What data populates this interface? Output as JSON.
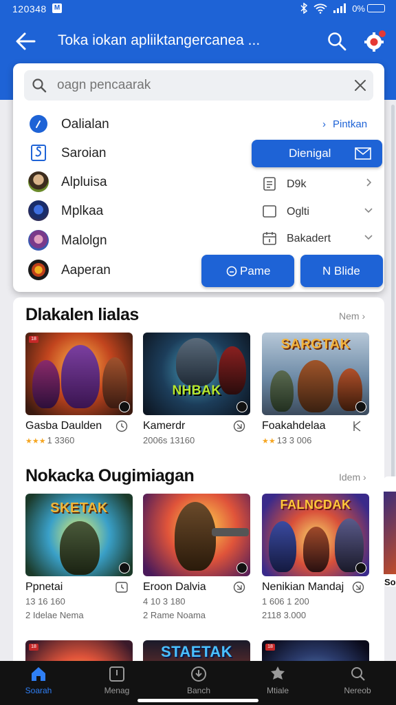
{
  "status_bar": {
    "time": "120348",
    "battery": "0%"
  },
  "app_bar": {
    "title": "Toka iokan apliiktangercanea ..."
  },
  "search": {
    "placeholder": "oagn pencaarak",
    "value": ""
  },
  "dropdown": {
    "options": [
      {
        "label": "Oalialan"
      },
      {
        "label": "Saroian"
      },
      {
        "label": "Alpluisa"
      },
      {
        "label": "Mplkaa"
      },
      {
        "label": "Malolgn"
      },
      {
        "label": "Aaperan"
      }
    ],
    "pin_link": "Pintkan",
    "primary_button": "Dienigal",
    "side_options": [
      {
        "label": "D9k"
      },
      {
        "label": "Oglti"
      },
      {
        "label": "Bakadert"
      }
    ],
    "action_left": "Pame",
    "action_right": "N Blide"
  },
  "sections": [
    {
      "title": "Dlakalen lialas",
      "more": "Nem",
      "cards": [
        {
          "name": "Gasba Daulden",
          "meta": "1 3360",
          "meta2": "",
          "stars": "★★★",
          "art_text": ""
        },
        {
          "name": "Kamerdr",
          "meta": "2006s 13160",
          "meta2": "",
          "stars": "",
          "art_text": "NHBAK"
        },
        {
          "name": "Foakahdelaa",
          "meta": "13 3 006",
          "meta2": "",
          "stars": "★★",
          "art_text": "SARGTAK"
        }
      ]
    },
    {
      "title": "Nokacka Ougimiagan",
      "more": "Idem",
      "cards": [
        {
          "name": "Ppnetai",
          "meta": "13 16 160",
          "meta2": "2 Idelae Nema",
          "stars": "",
          "art_text": "SKETAK"
        },
        {
          "name": "Eroon Dalvia",
          "meta": "4 10 3 180",
          "meta2": "2 Rame Noama",
          "stars": "",
          "art_text": ""
        },
        {
          "name": "Nenikian Mandaj",
          "meta": "1 606 1 200",
          "meta2": "2118 3.000",
          "stars": "",
          "art_text": "FALNCDAK"
        }
      ]
    }
  ],
  "peek_card": {
    "label": "So"
  },
  "third_row": {
    "art_text": "STAETAK"
  },
  "bottom_nav": [
    {
      "label": "Soarah",
      "icon": "home-icon",
      "active": true
    },
    {
      "label": "Menag",
      "icon": "library-icon",
      "active": false
    },
    {
      "label": "Banch",
      "icon": "download-icon",
      "active": false
    },
    {
      "label": "Mtiale",
      "icon": "games-icon",
      "active": false
    },
    {
      "label": "Nereob",
      "icon": "profile-icon",
      "active": false
    }
  ],
  "colors": {
    "accent": "#1e63d6",
    "nav_bg": "#121212",
    "active_nav": "#2f7ff5"
  }
}
